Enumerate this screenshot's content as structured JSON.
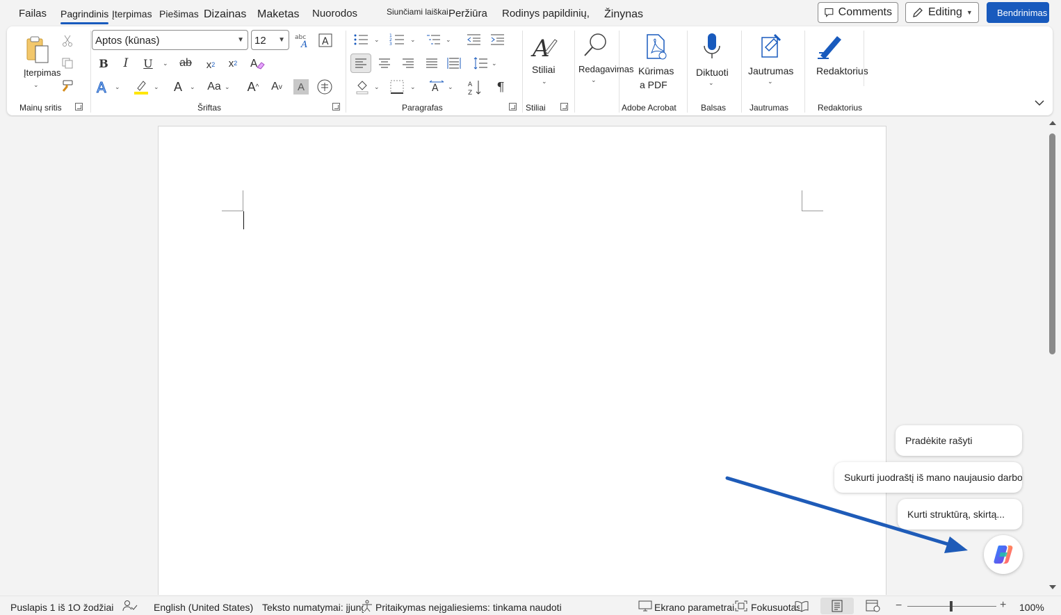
{
  "menu": {
    "tabs": [
      "Failas",
      "Pagrindinis",
      "Įterpimas",
      "Piešimas",
      "Dizainas",
      "Maketas",
      "Nuorodos",
      "Siunčiami laiškai",
      "Peržiūra",
      "Rodinys papildinių,",
      "Žinynas"
    ],
    "active_tab": "Pagrindinis"
  },
  "top_buttons": {
    "comments": "Comments",
    "editing": "Editing",
    "share": "Bendrinimas"
  },
  "ribbon": {
    "clipboard": {
      "paste_label": "Įterpimas",
      "group_label": "Mainų sritis"
    },
    "font": {
      "name": "Aptos (kūnas)",
      "size": "12",
      "group_label": "Šriftas"
    },
    "paragraph": {
      "group_label": "Paragrafas"
    },
    "styles": {
      "label": "Stiliai",
      "group_label": "Stiliai"
    },
    "editing": {
      "label": "Redagavimas"
    },
    "acrobat": {
      "label_line1": "Kūrimas",
      "label_line2": "a PDF",
      "group_label": "Adobe Acrobat"
    },
    "voice": {
      "label": "Diktuoti",
      "group_label": "Balsas"
    },
    "sensitivity": {
      "label": "Jautrumas",
      "group_label": "Jautrumas"
    },
    "editor": {
      "label": "Redaktorius",
      "group_label": "Redaktorius"
    }
  },
  "copilot": {
    "suggestions": [
      "Pradėkite rašyti",
      "Sukurti juodraštį iš mano naujausio darbo",
      "Kurti struktūrą, skirtą..."
    ]
  },
  "status": {
    "page": "Puslapis 1 iš 1",
    "words": "O žodžiai",
    "language": "English (United States)",
    "predictions": "Teksto numatymai: įjungta",
    "accessibility": "Pritaikymas neįgaliesiems: tinkama naudoti",
    "display_settings": "Ekrano parametrai",
    "focus": "Fokusuotas",
    "zoom": "100%"
  }
}
